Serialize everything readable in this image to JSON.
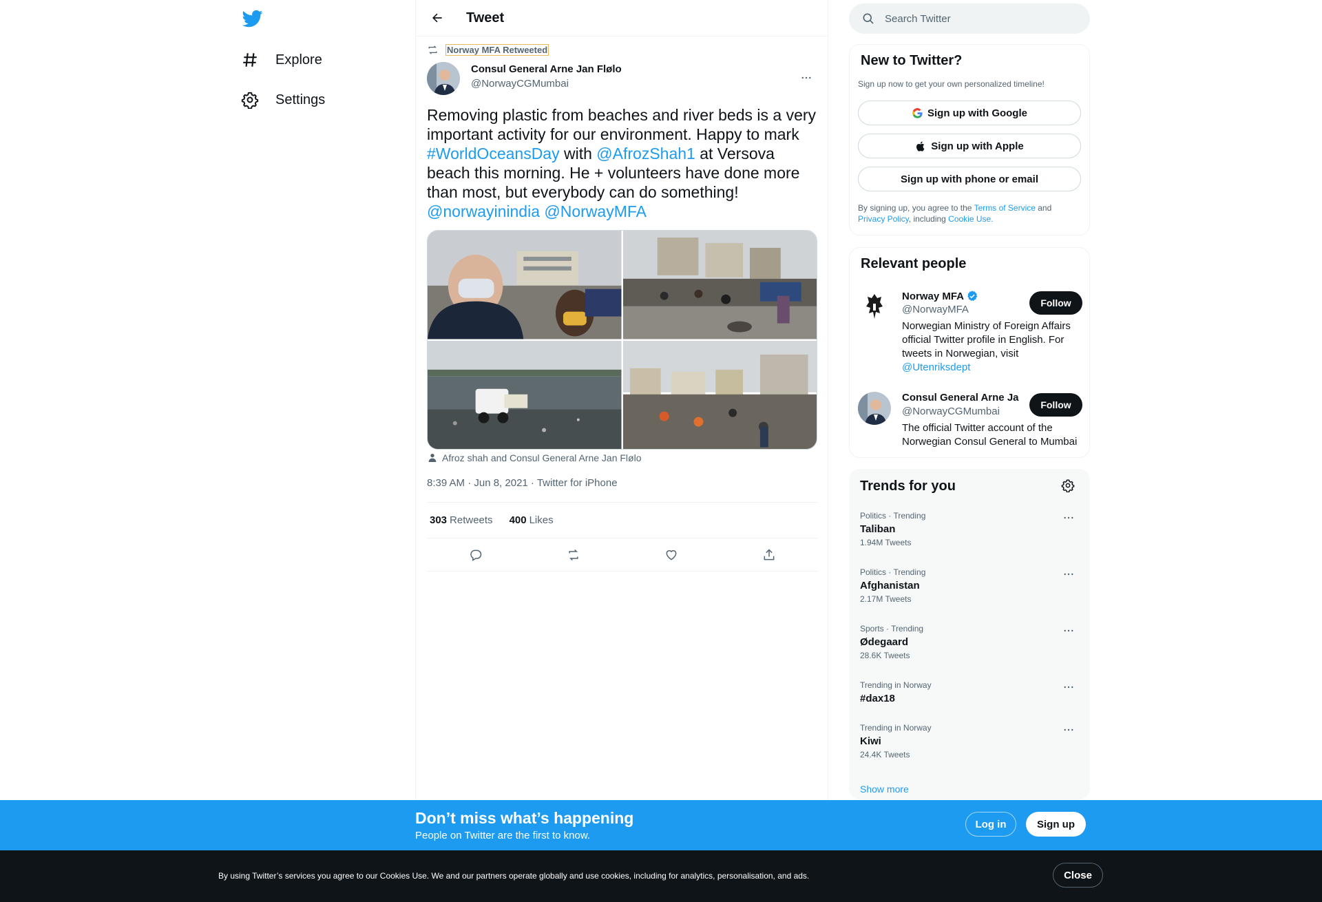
{
  "nav": {
    "logo": "twitter-bird-icon",
    "items": [
      {
        "label": "Explore",
        "icon": "hashtag-icon"
      },
      {
        "label": "Settings",
        "icon": "gear-icon"
      }
    ]
  },
  "header": {
    "title": "Tweet"
  },
  "tweet": {
    "retweeted_by": "Norway MFA Retweeted",
    "author": {
      "name": "Consul General Arne Jan Flølo",
      "handle": "@NorwayCGMumbai"
    },
    "text": {
      "p1": "Removing plastic from beaches and river beds is a very important activity for our environment. Happy to mark ",
      "tag1": "#WorldOceansDay",
      "p2": " with ",
      "mention1": "@AfrozShah1",
      "p3": " at Versova beach this morning. He + volunteers have done more than most, but everybody can do something! ",
      "mention2": "@norwayinindia",
      "mention3": "@NorwayMFA"
    },
    "tagged_people": "Afroz shah and Consul General Arne Jan Flølo",
    "meta": "8:39 AM · Jun 8, 2021 · Twitter for iPhone",
    "retweets": {
      "count": "303",
      "label": "Retweets"
    },
    "likes": {
      "count": "400",
      "label": "Likes"
    }
  },
  "search": {
    "placeholder": "Search Twitter"
  },
  "new_to_twitter": {
    "title": "New to Twitter?",
    "subtitle": "Sign up now to get your own personalized timeline!",
    "google": "Sign up with Google",
    "apple": "Sign up with Apple",
    "phone": "Sign up with phone or email",
    "legal": {
      "a": "By signing up, you agree to the ",
      "tos": "Terms of Service",
      "b": " and ",
      "privacy": "Privacy Policy",
      "c": ", including ",
      "cookie": "Cookie Use."
    }
  },
  "relevant_people": {
    "title": "Relevant people",
    "people": [
      {
        "name": "Norway MFA",
        "handle": "@NorwayMFA",
        "bio": "Norwegian Ministry of Foreign Affairs official Twitter profile in English. For tweets in Norwegian, visit ",
        "bio_link": "@Utenriksdept",
        "follow": "Follow"
      },
      {
        "name": "Consul General Arne Ja",
        "handle": "@NorwayCGMumbai",
        "bio": "The official Twitter account of the Norwegian Consul General to Mumbai",
        "bio_link": "",
        "follow": "Follow"
      }
    ]
  },
  "trends": {
    "title": "Trends for you",
    "items": [
      {
        "context": "Politics · Trending",
        "name": "Taliban",
        "count": "1.94M Tweets"
      },
      {
        "context": "Politics · Trending",
        "name": "Afghanistan",
        "count": "2.17M Tweets"
      },
      {
        "context": "Sports · Trending",
        "name": "Ødegaard",
        "count": "28.6K Tweets"
      },
      {
        "context": "Trending in Norway",
        "name": "#dax18",
        "count": ""
      },
      {
        "context": "Trending in Norway",
        "name": "Kiwi",
        "count": "24.4K Tweets"
      }
    ],
    "show_more": "Show more"
  },
  "signup_bar": {
    "headline": "Don’t miss what’s happening",
    "sub": "People on Twitter are the first to know.",
    "login": "Log in",
    "signup": "Sign up"
  },
  "cookie_bar": {
    "text": "By using Twitter’s services you agree to our Cookies Use. We and our partners operate globally and use cookies, including for analytics, personalisation, and ads.",
    "close": "Close"
  },
  "colors": {
    "accent": "#1d9bf0",
    "text": "#0f1419",
    "muted": "#536471",
    "dark": "#0f1419"
  }
}
